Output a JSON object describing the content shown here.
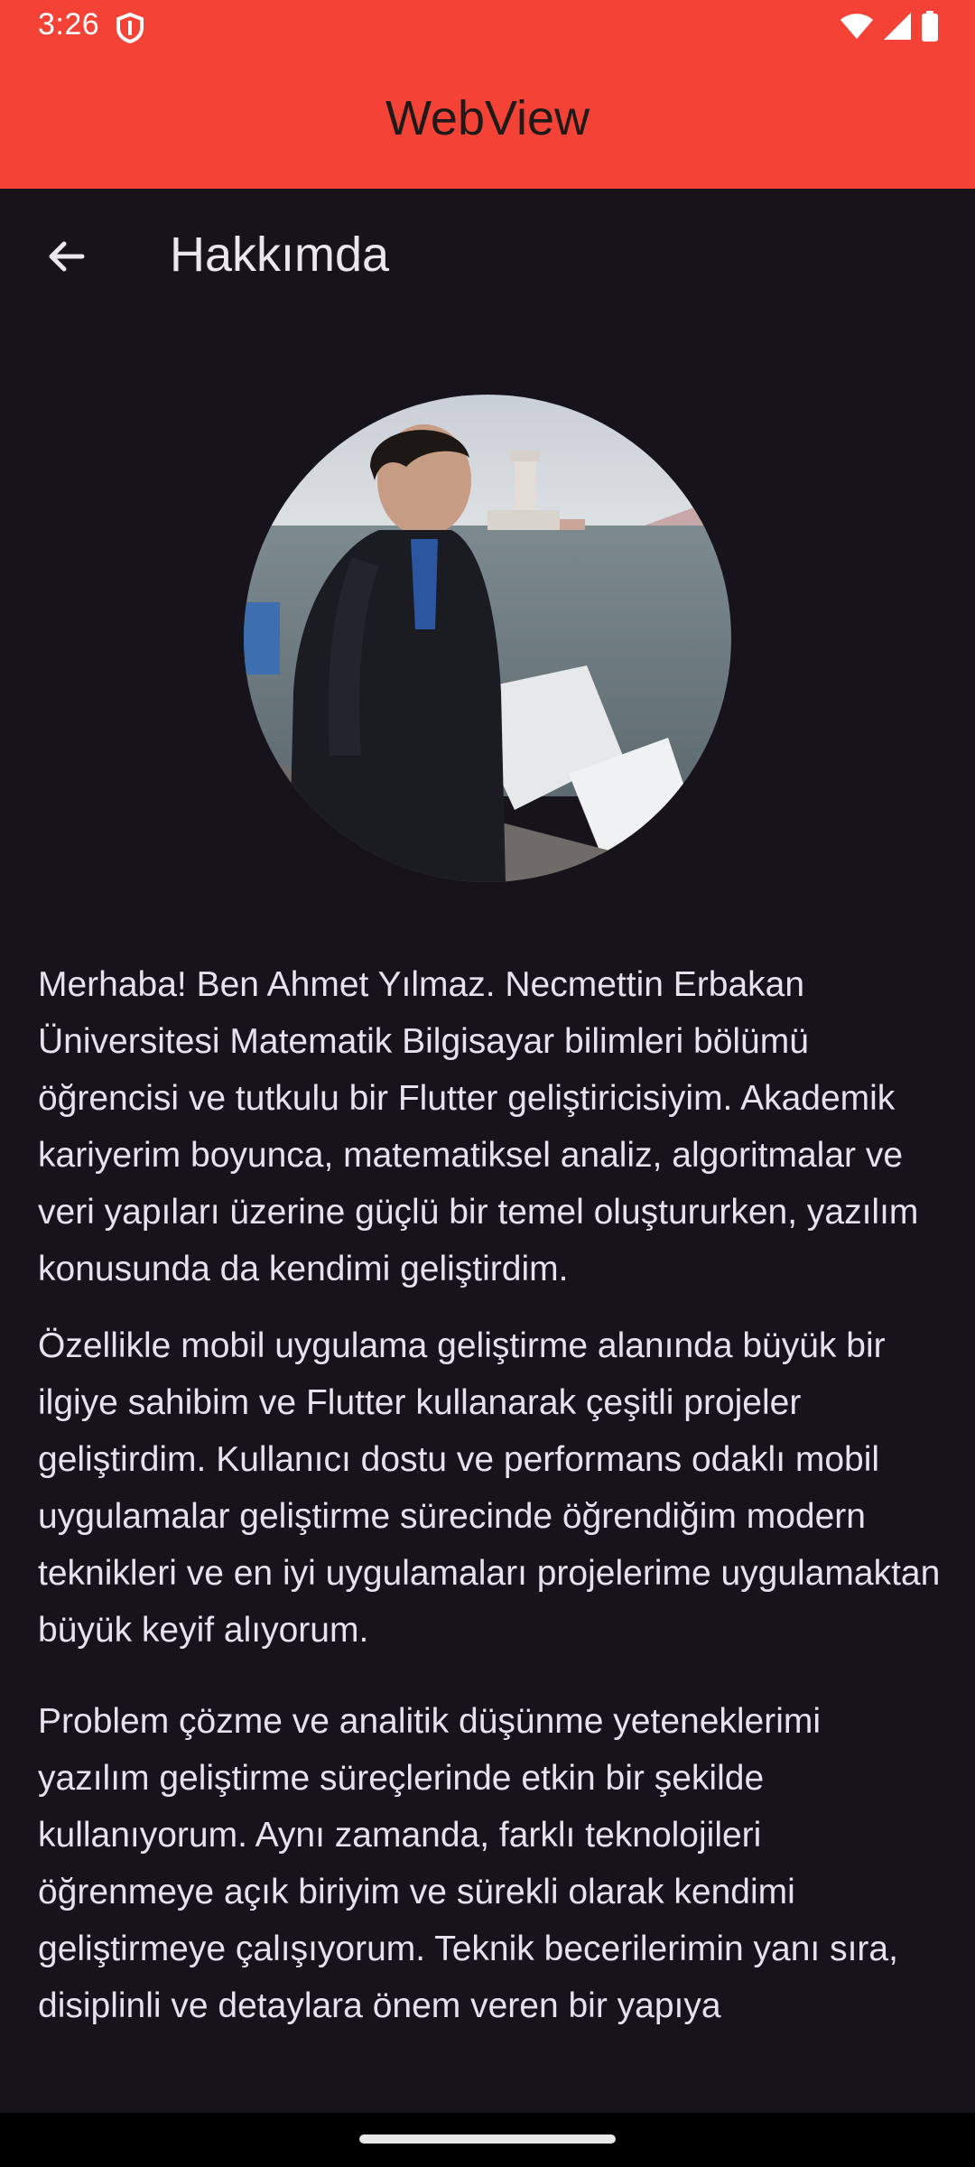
{
  "status_bar": {
    "time": "3:26",
    "icons": [
      "shield-icon",
      "wifi-icon",
      "signal-icon",
      "battery-icon"
    ]
  },
  "app_bar": {
    "title": "WebView",
    "color": "#f44336"
  },
  "page": {
    "title": "Hakkımda",
    "background": "#16131b",
    "avatar": "profile-photo",
    "paragraphs": [
      "Merhaba! Ben Ahmet Yılmaz. Necmettin Erbakan Üniversitesi Matematik Bilgisayar bilimleri bölümü öğrencisi ve tutkulu bir Flutter geliştiricisiyim. Akademik kariyerim boyunca, matematiksel analiz, algoritmalar ve veri yapıları üzerine güçlü bir temel oluştururken, yazılım konusunda da kendimi geliştirdim.",
      "Özellikle mobil uygulama geliştirme alanında büyük bir ilgiye sahibim ve Flutter kullanarak çeşitli projeler geliştirdim. Kullanıcı dostu ve performans odaklı mobil uygulamalar geliştirme sürecinde öğrendiğim modern teknikleri ve en iyi uygulamaları projelerime uygulamaktan büyük keyif alıyorum.",
      "Problem çözme ve analitik düşünme yeteneklerimi yazılım geliştirme süreçlerinde etkin bir şekilde kullanıyorum. Aynı zamanda, farklı teknolojileri öğrenmeye açık biriyim ve sürekli olarak kendimi geliştirmeye çalışıyorum. Teknik becerilerimin yanı sıra, disiplinli ve detaylara önem veren bir yapıya"
    ]
  }
}
